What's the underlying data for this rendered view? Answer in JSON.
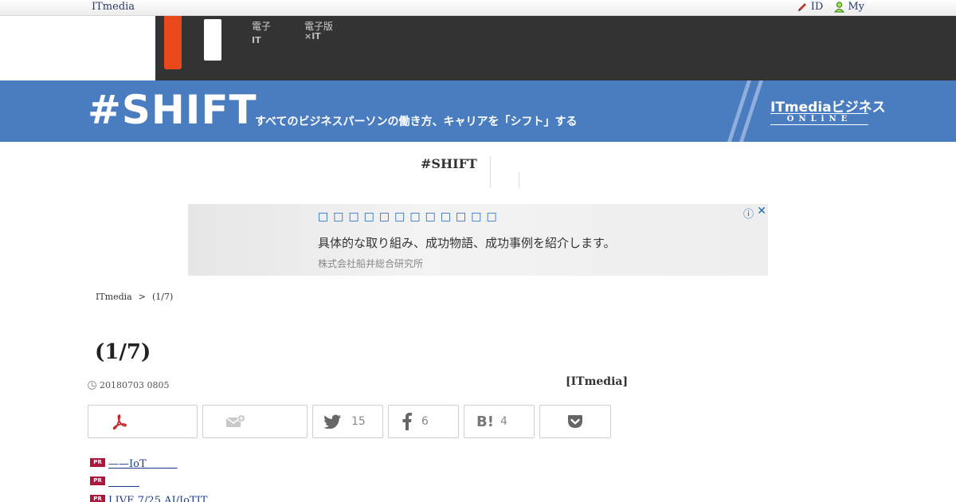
{
  "topbar": {
    "brand": "ITmedia",
    "id_label": "ID",
    "my_label": "My"
  },
  "darknav": {
    "item1_line1": "電子",
    "item1_line2": "IT",
    "item2_line1": "電子版",
    "item2_line2": "×IT"
  },
  "banner": {
    "logo": "#SHIFT",
    "tagline": "すべてのビジネスパーソンの働き方、キャリアを「シフト」する",
    "itmedia": "ITmediaビジネス",
    "online": "ONLiNE"
  },
  "subnav": {
    "title": "#SHIFT"
  },
  "ad": {
    "headline": "□□□□□□□□□□□□",
    "body": "具体的な取り組み、成功物語、成功事例を紹介します。",
    "sponsor": "株式会社船井総合研究所",
    "info_icon": "ⓘ",
    "close_icon": "✕"
  },
  "breadcrumb": [
    "ITmedia",
    ">",
    "(1/7)"
  ],
  "article": {
    "title": "(1/7)",
    "date": "20180703 0805",
    "author": "[ITmedia]"
  },
  "share": {
    "twitter_count": "15",
    "facebook_count": "6",
    "hatena_count": "4"
  },
  "pr_links": [
    {
      "badge": "PR",
      "text": "——IoT　　　"
    },
    {
      "badge": "PR",
      "text": "　　　"
    },
    {
      "badge": "PR",
      "text": "LIVE 7/25 AI/IoTIT　"
    }
  ],
  "colors": {
    "banner_blue": "#4a7cc0",
    "nav_dark": "#333333",
    "accent_orange": "#e8481c",
    "pr_red": "#b0163a",
    "link_blue": "#1a3c8c"
  }
}
